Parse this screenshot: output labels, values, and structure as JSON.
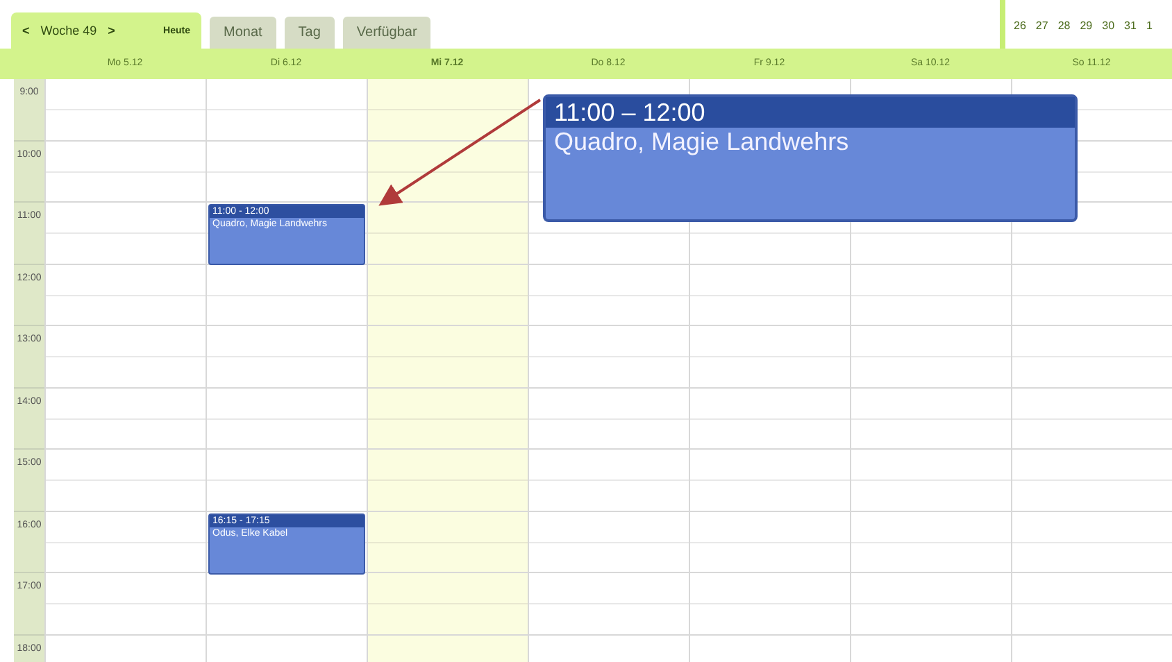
{
  "toolbar": {
    "prev": "<",
    "week": "Woche 49",
    "next": ">",
    "today": "Heute"
  },
  "tabs": [
    {
      "label": "Monat",
      "selected": false
    },
    {
      "label": "Tag",
      "selected": false
    },
    {
      "label": "Verfügbar",
      "selected": false
    }
  ],
  "mini_calendar": [
    "26",
    "27",
    "28",
    "29",
    "30",
    "31",
    "1"
  ],
  "days": [
    {
      "label": "Mo 5.12",
      "selected": false
    },
    {
      "label": "Di 6.12",
      "selected": false
    },
    {
      "label": "Mi 7.12",
      "selected": true
    },
    {
      "label": "Do 8.12",
      "selected": false
    },
    {
      "label": "Fr 9.12",
      "selected": false
    },
    {
      "label": "Sa 10.12",
      "selected": false
    },
    {
      "label": "So 11.12",
      "selected": false
    }
  ],
  "rows": [
    {
      "time": "9:00",
      "cells": [
        null,
        null,
        null,
        null,
        null,
        null,
        null
      ]
    },
    {
      "time": "10:00",
      "cells": [
        null,
        null,
        null,
        null,
        null,
        null,
        null
      ]
    },
    {
      "time": "11:00",
      "cells": [
        null,
        {
          "time": "11:00 - 12:00",
          "title": "Quadro, Magie Landwehrs"
        },
        null,
        null,
        null,
        null,
        null
      ]
    },
    {
      "time": "12:00",
      "cells": [
        null,
        null,
        null,
        null,
        null,
        null,
        null
      ]
    },
    {
      "time": "13:00",
      "cells": [
        null,
        null,
        null,
        null,
        null,
        null,
        null
      ]
    },
    {
      "time": "14:00",
      "cells": [
        null,
        null,
        null,
        null,
        null,
        null,
        null
      ]
    },
    {
      "time": "15:00",
      "cells": [
        null,
        null,
        null,
        null,
        null,
        null,
        null
      ]
    },
    {
      "time": "16:00",
      "cells": [
        null,
        {
          "time": "16:15 - 17:15",
          "title": "Odus, Elke Kabel"
        },
        null,
        null,
        null,
        null,
        null
      ]
    },
    {
      "time": "17:00",
      "cells": [
        null,
        null,
        null,
        null,
        null,
        null,
        null
      ]
    },
    {
      "time": "18:00",
      "cells": [
        null,
        null,
        null,
        null,
        null,
        null,
        null
      ]
    }
  ],
  "zoom_callout": {
    "time": "11:00 – 12:00",
    "title": "Quadro, Magie Landwehrs"
  }
}
